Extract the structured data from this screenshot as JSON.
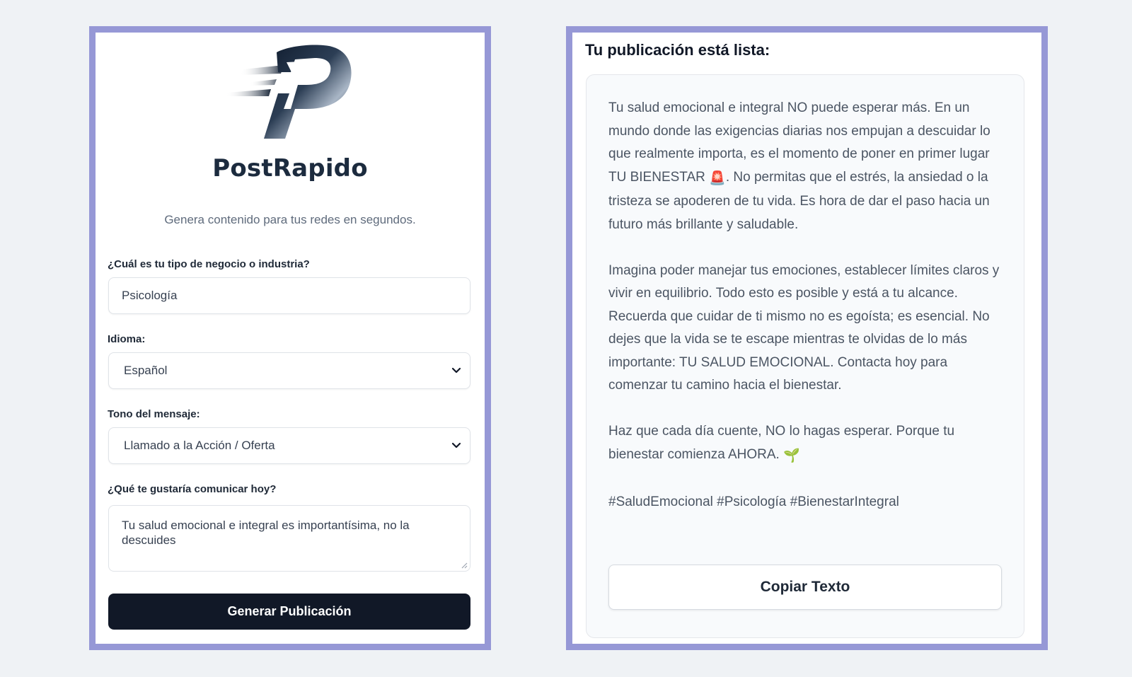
{
  "brand": {
    "name": "PostRapido",
    "tagline": "Genera contenido para tus redes en segundos."
  },
  "form": {
    "industry": {
      "label": "¿Cuál es tu tipo de negocio o industria?",
      "value": "Psicología"
    },
    "language": {
      "label": "Idioma:",
      "selected": "Español"
    },
    "tone": {
      "label": "Tono del mensaje:",
      "selected": "Llamado a la Acción / Oferta"
    },
    "message": {
      "label": "¿Qué te gustaría comunicar hoy?",
      "value": "Tu salud emocional e integral es importantísima, no la descuides"
    },
    "submit_label": "Generar Publicación"
  },
  "result": {
    "heading": "Tu publicación está lista:",
    "paragraph1_a": "Tu salud emocional e integral NO puede esperar más. En un mundo donde las exigencias diarias nos empujan a descuidar lo que realmente importa, es el momento de poner en primer lugar TU BIENESTAR",
    "paragraph1_emoji": "🚨",
    "paragraph1_b": ". No permitas que el estrés, la ansiedad o la tristeza se apoderen de tu vida. Es hora de dar el paso hacia un futuro más brillante y saludable.",
    "paragraph2": "Imagina poder manejar tus emociones, establecer límites claros y vivir en equilibrio. Todo esto es posible y está a tu alcance. Recuerda que cuidar de ti mismo no es egoísta; es esencial. No dejes que la vida se te escape mientras te olvidas de lo más importante: TU SALUD EMOCIONAL. Contacta hoy para comenzar tu camino hacia el bienestar.",
    "paragraph3_a": "Haz que cada día cuente, NO lo hagas esperar. Porque tu bienestar comienza AHORA.",
    "paragraph3_emoji": "🌱",
    "hashtags": "#SaludEmocional #Psicología #BienestarIntegral",
    "copy_label": "Copiar Texto"
  },
  "colors": {
    "page_background": "#eff2f5",
    "panel_border": "#9698d6",
    "primary_button": "#111827",
    "brand_text": "#1c2b3e"
  },
  "icons": {
    "logo": "postrapido-p-logo",
    "select_arrow": "chevron-down-icon",
    "textarea_resize": "resize-grip-icon"
  }
}
